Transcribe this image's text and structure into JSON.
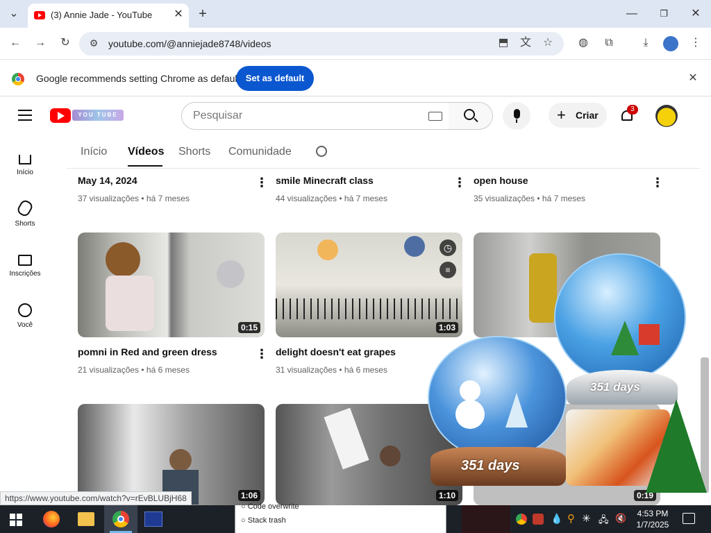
{
  "browser": {
    "tab_title": "(3) Annie Jade - YouTube",
    "url": "youtube.com/@anniejade8748/videos",
    "infobar_message": "Google recommends setting Chrome as default",
    "set_default_label": "Set as default"
  },
  "youtube": {
    "search_placeholder": "Pesquisar",
    "create_label": "Criar",
    "notification_count": "3",
    "logo_text": "YOU TUBE"
  },
  "sidebar": [
    {
      "label": "Início"
    },
    {
      "label": "Shorts"
    },
    {
      "label": "Inscrições"
    },
    {
      "label": "Você"
    }
  ],
  "channel_tabs": [
    "Início",
    "Vídeos",
    "Shorts",
    "Comunidade"
  ],
  "videos_row1": [
    {
      "title": "May 14, 2024",
      "meta": "37 visualizações • há 7 meses"
    },
    {
      "title": "smile Minecraft class",
      "meta": "44 visualizações • há 7 meses"
    },
    {
      "title": "open house",
      "meta": "35 visualizações • há 7 meses"
    }
  ],
  "videos_row2": [
    {
      "title": "pomni in Red and green dress",
      "meta": "21 visualizações • há 6 meses",
      "duration": "0:15"
    },
    {
      "title": "delight doesn't eat grapes",
      "meta": "31 visualizações • há 6 meses",
      "duration": "1:03"
    }
  ],
  "videos_row3": [
    {
      "duration": "1:06"
    },
    {
      "duration": "1:10"
    },
    {
      "duration": "0:19"
    }
  ],
  "overlay": {
    "globe_label_1": "351 days",
    "globe_label_2": "351 days"
  },
  "status_url": "https://www.youtube.com/watch?v=rEvBLUBjH68",
  "background_window": {
    "option1": "Code overwrite",
    "option2": "Stack trash"
  },
  "taskbar": {
    "time": "4:53 PM",
    "date": "1/7/2025"
  }
}
